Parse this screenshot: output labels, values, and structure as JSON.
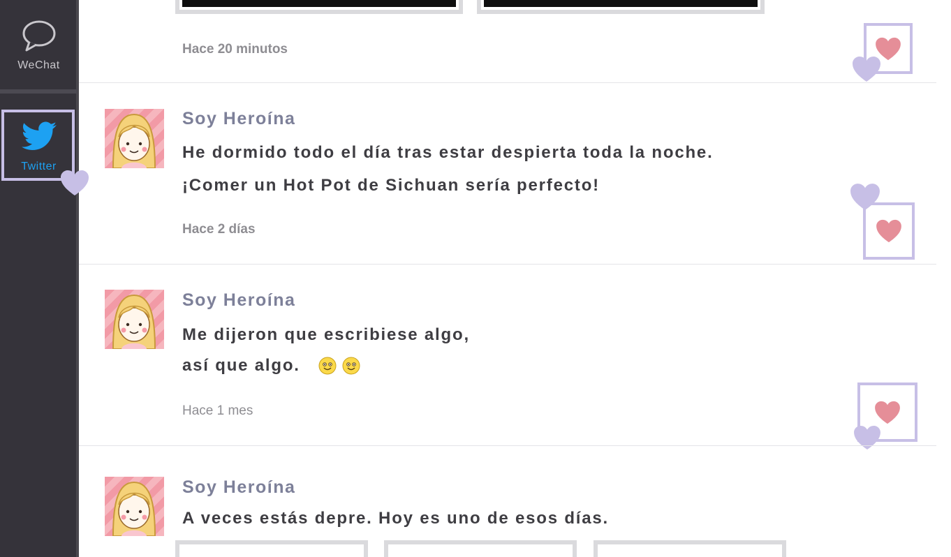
{
  "sidebar": {
    "items": [
      {
        "label": "WeChat",
        "icon": "chat-bubble-icon"
      },
      {
        "label": "Twitter",
        "icon": "twitter-bird-icon",
        "active": true
      }
    ]
  },
  "colors": {
    "sidebar_bg": "#35333a",
    "twitter_blue": "#1da1f2",
    "author": "#7d8099",
    "heart": "#e58e98",
    "frame": "#c7bfe6"
  },
  "feed": {
    "posts": [
      {
        "time": "Hace 20 minutos"
      },
      {
        "author": "Soy Heroína",
        "line1": "He dormido todo el día tras estar despierta toda la noche.",
        "line2": "¡Comer un Hot Pot de Sichuan sería perfecto!",
        "time": "Hace 2 días"
      },
      {
        "author": "Soy Heroína",
        "line1": "Me dijeron que escribiese algo,",
        "line2": "así que algo.",
        "emojis": [
          "smile-emoji",
          "smile-emoji"
        ],
        "time": "Hace 1 mes"
      },
      {
        "author": "Soy Heroína",
        "line1": "A veces estás depre. Hoy es uno de esos días."
      }
    ]
  }
}
